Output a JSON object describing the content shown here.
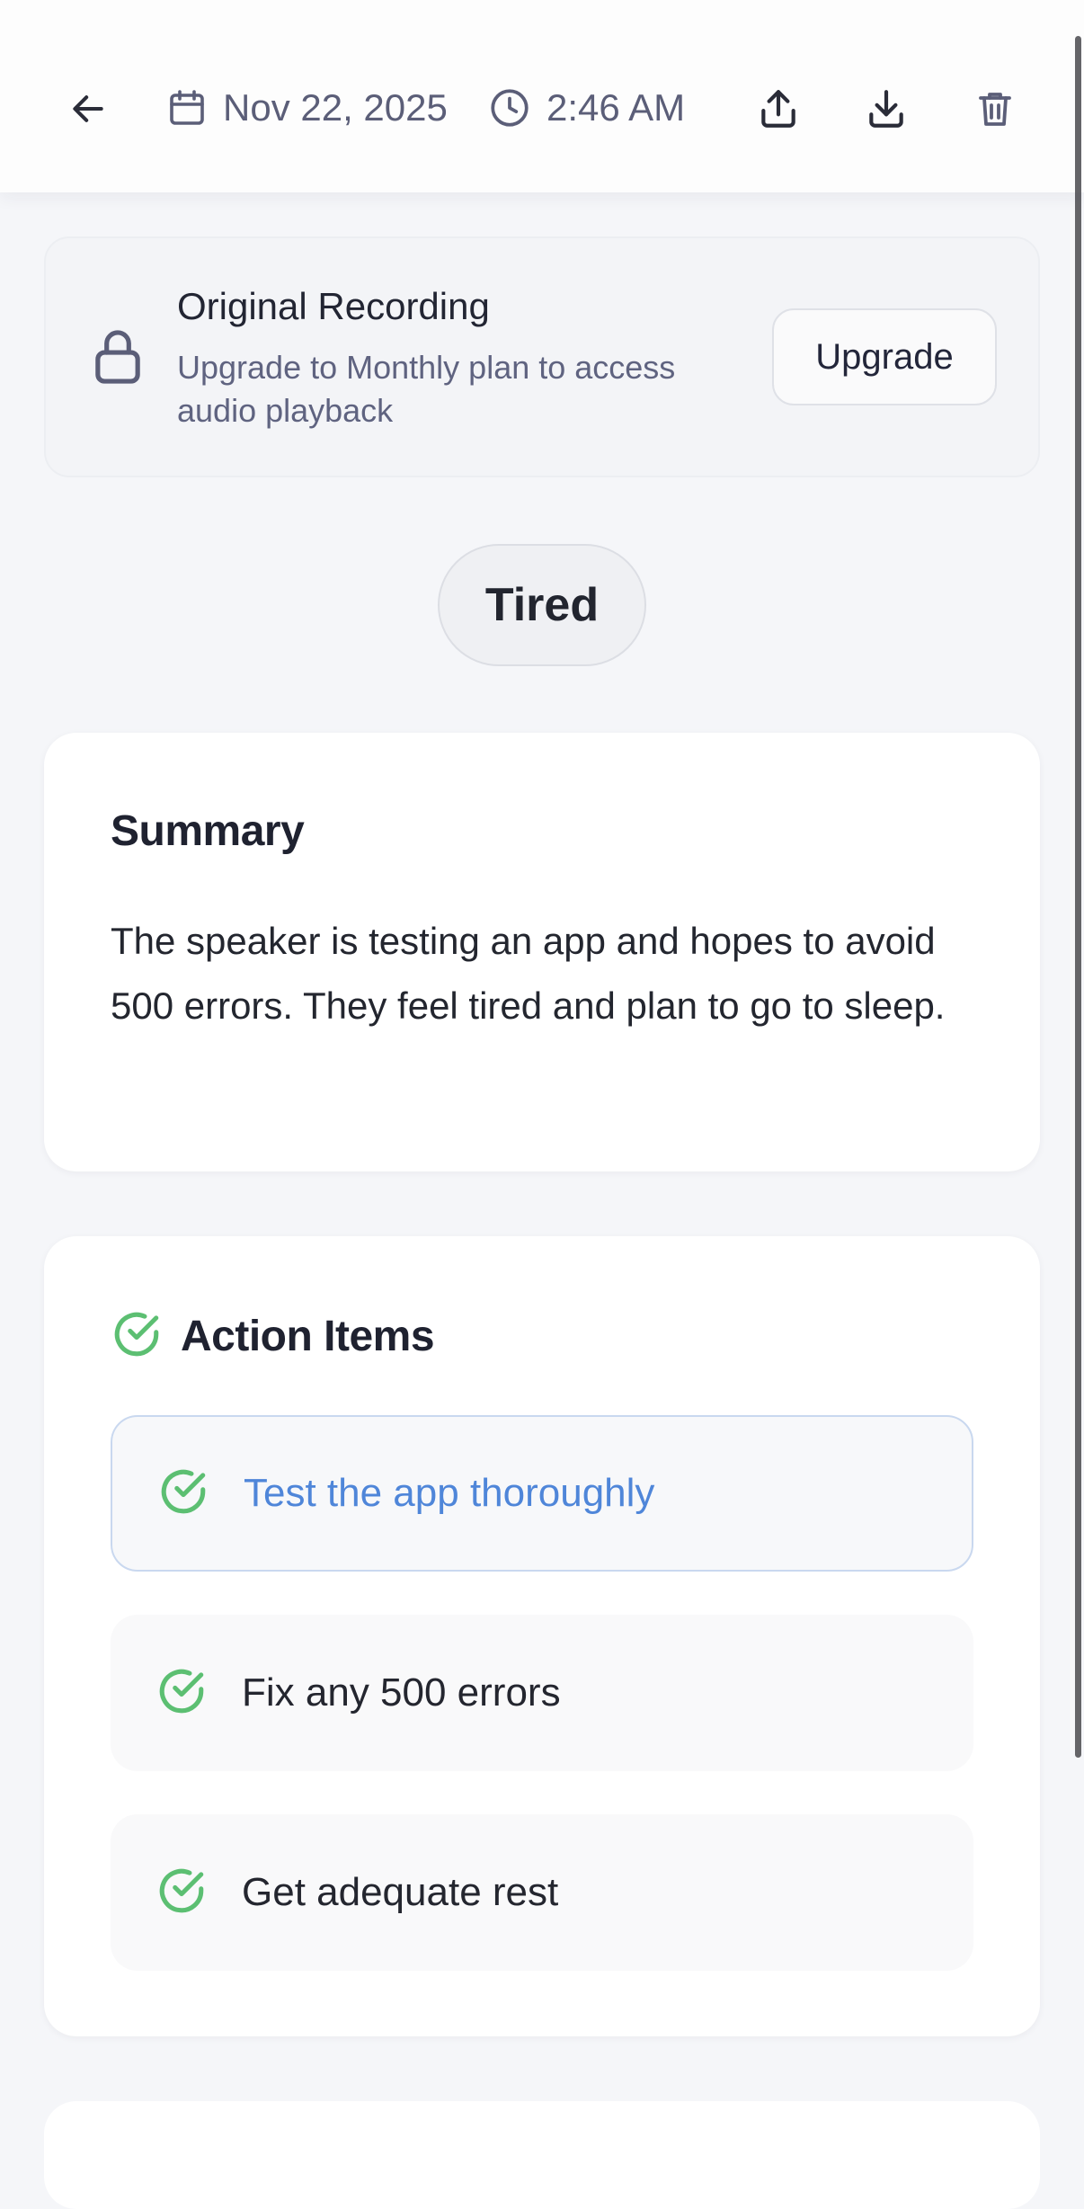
{
  "header": {
    "date": "Nov 22, 2025",
    "time": "2:46 AM",
    "icons": [
      "back-arrow-icon",
      "calendar-icon",
      "clock-icon",
      "share-icon",
      "download-icon",
      "trash-icon"
    ]
  },
  "recording": {
    "title": "Original Recording",
    "subtitle": "Upgrade to Monthly plan to access audio playback",
    "upgrade_label": "Upgrade",
    "icon": "lock-icon"
  },
  "mood": {
    "label": "Tired"
  },
  "summary": {
    "title": "Summary",
    "text": "The speaker is testing an app and hopes to avoid 500 errors. They feel tired and plan to go to sleep."
  },
  "action_items": {
    "title": "Action Items",
    "items": [
      {
        "label": "Test the app thoroughly",
        "active": true
      },
      {
        "label": "Fix any 500 errors",
        "active": false
      },
      {
        "label": "Get adequate rest",
        "active": false
      }
    ]
  },
  "colors": {
    "accent_green": "#5cbf72",
    "accent_blue": "#4f86d9",
    "muted_text": "#5b5e78",
    "background": "#f5f6f9"
  }
}
